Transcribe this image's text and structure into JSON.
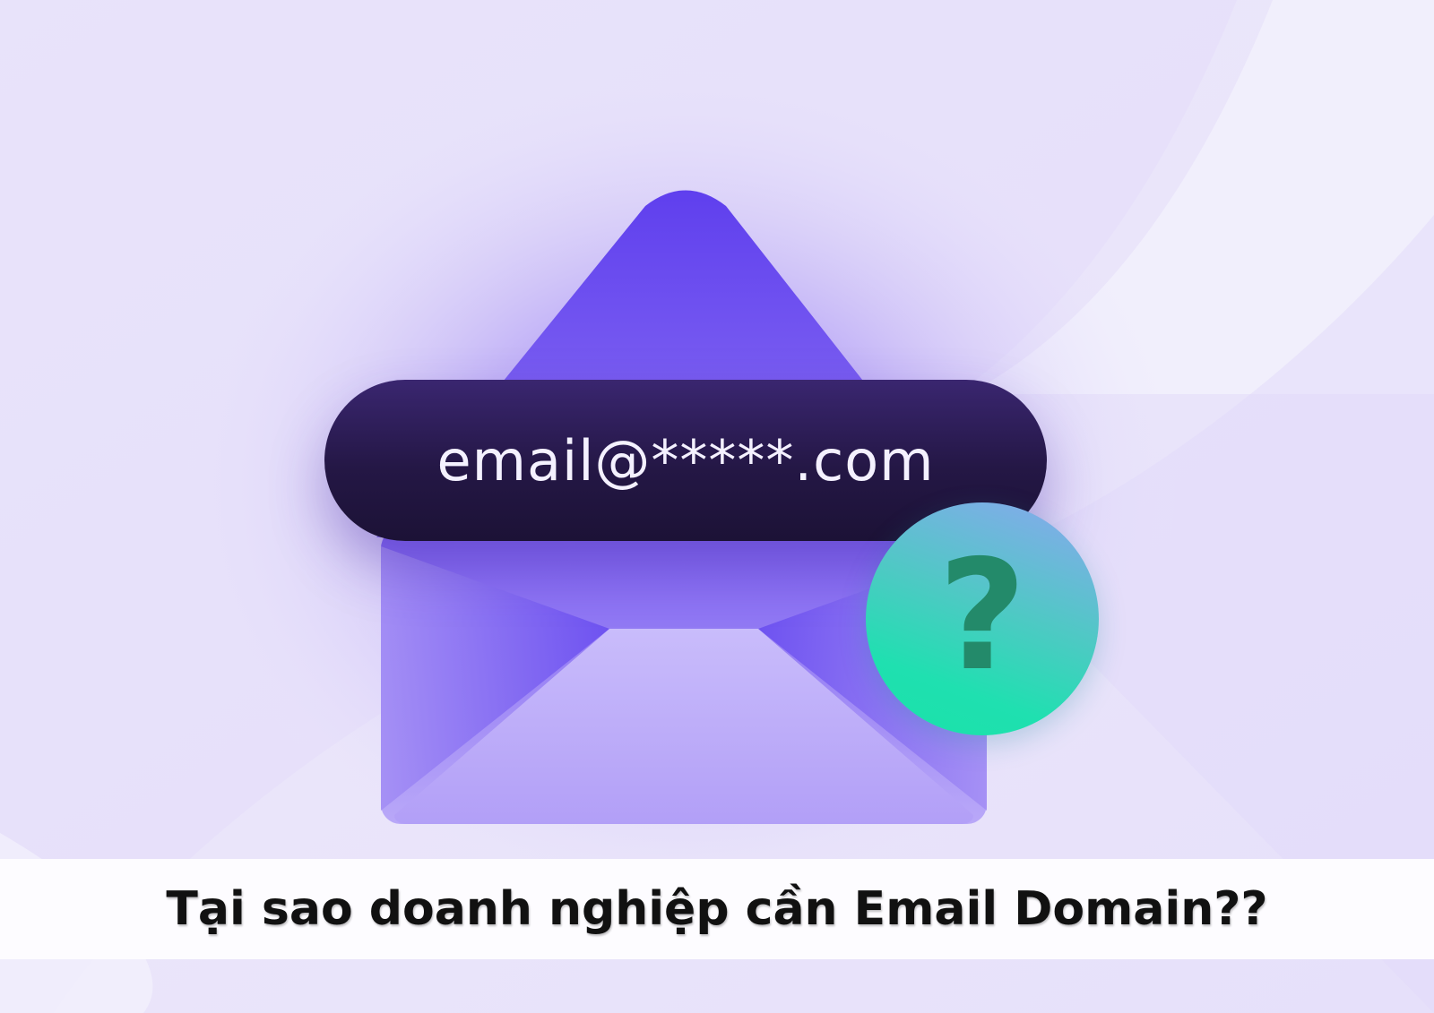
{
  "email_address": "email@*****.com",
  "help_symbol": "?",
  "caption": "Tại sao doanh nghiệp cần Email Domain??",
  "icons": {
    "envelope": "open-envelope-icon",
    "help": "question-mark-icon"
  },
  "colors": {
    "background": "#ece8fb",
    "envelope_flap": "#6a4ef0",
    "envelope_body": "#b7a6f8",
    "email_pill": "#241745",
    "help_badge_top": "#8aa7f0",
    "help_badge_bottom": "#1ae2a8",
    "caption_bar": "#fdfcff",
    "caption_text": "#111111"
  }
}
